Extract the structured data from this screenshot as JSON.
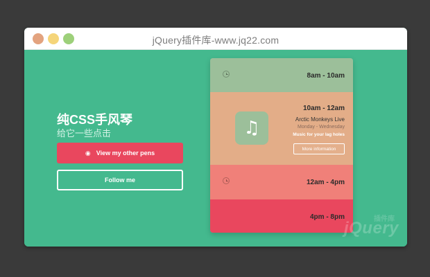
{
  "window": {
    "title": "jQuery插件库-www.jq22.com"
  },
  "hero": {
    "title": "纯CSS手风琴",
    "subtitle": "给它一些点击",
    "primary_button": "View my other pens",
    "secondary_button": "Follow me"
  },
  "card": {
    "slots": [
      {
        "time": "8am - 10am"
      },
      {
        "time": "10am - 12am",
        "event": "Arctic Monkeys Live",
        "days": "Monday - Wednesday",
        "tagline": "Music for your lag holes",
        "button": "More information"
      },
      {
        "time": "12am - 4pm"
      },
      {
        "time": "4pm - 8pm"
      }
    ]
  },
  "watermark": {
    "text": "jQuery",
    "sub": "插件库"
  },
  "icons": {
    "eye": "eye-icon",
    "music": "music-note-icon",
    "clock": "alarm-clock-icon"
  },
  "colors": {
    "background": "#44b98e",
    "primary": "#e9475e",
    "slot1": "#9cbf9a",
    "slot2": "#e3ad88",
    "slot3": "#f08079",
    "slot4": "#e9475e"
  }
}
